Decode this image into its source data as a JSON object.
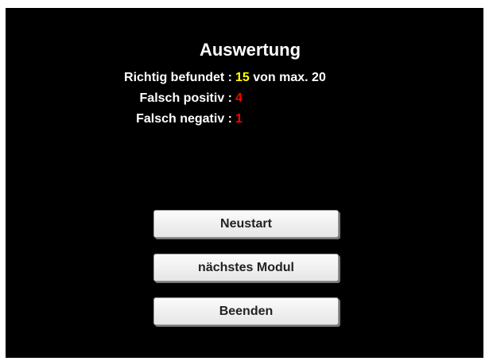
{
  "result": {
    "title": "Auswertung",
    "rows": [
      {
        "label": "Richtig befundet :",
        "value": "15",
        "suffix": "von max. 20",
        "value_color": "#ffff00"
      },
      {
        "label": "Falsch positiv :",
        "value": "4",
        "suffix": "",
        "value_color": "#ff0000"
      },
      {
        "label": "Falsch negativ :",
        "value": "1",
        "suffix": "",
        "value_color": "#ff0000"
      }
    ]
  },
  "buttons": {
    "restart": "Neustart",
    "next_module": "nächstes Modul",
    "quit": "Beenden"
  },
  "colors": {
    "background": "#000000",
    "text": "#ffffff",
    "highlight": "#ffff00",
    "error": "#ff0000"
  }
}
